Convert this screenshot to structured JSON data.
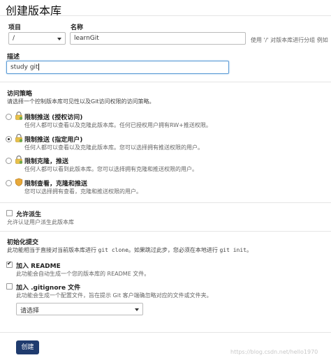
{
  "page_title": "创建版本库",
  "repo": {
    "project_label": "项目",
    "name_label": "名称",
    "project_value": "/",
    "name_value": "learnGit",
    "name_hint": "使用 '/' 对版本库进行分组 例如"
  },
  "description": {
    "label": "描述",
    "value": "study git"
  },
  "access": {
    "heading": "访问策略",
    "subheading": "请选择一个控制版本库可见性以及Git访问权限的访问策略。",
    "options": [
      {
        "title": "限制推送 (授权访问)",
        "desc": "任何人都可以查看以及克隆此版本库。任何已授权用户拥有RW+推送权限。",
        "selected": false
      },
      {
        "title": "限制推送 (指定用户)",
        "desc": "任何人都可以查看以及克隆此版本库。您可以选择拥有推送权限的用户。",
        "selected": true
      },
      {
        "title": "限制克隆，推送",
        "desc": "任何人都可以看到此版本库。您可以选择拥有克隆和推送权限的用户。",
        "selected": false
      },
      {
        "title": "限制查看，克隆和推送",
        "desc": "您可以选择拥有查看，克隆和推送权限的用户。",
        "selected": false
      }
    ]
  },
  "fork": {
    "label": "允许派生",
    "desc": "允许认证用户派生此版本库",
    "checked": false
  },
  "init": {
    "heading": "初始化提交",
    "desc_a": "此功能相当于直接对当前版本库进行",
    "cmd1": "git clone",
    "desc_b": "。如果跳过此步，您必须在本地进行",
    "cmd2": "git init",
    "desc_c": "。",
    "readme_label": "加入 README",
    "readme_desc": "此功能会自动生成一个您的版本库的 README 文件。",
    "readme_checked": true,
    "gitignore_label": "加入 .gitignore 文件",
    "gitignore_desc": "此功能会生成一个配置文件，旨在提示 Git 客户端确忽略对应的文件或文件夹。",
    "gitignore_checked": false,
    "select_value": "请选择"
  },
  "create_button": "创建",
  "watermark": "https://blog.csdn.net/hello1970"
}
